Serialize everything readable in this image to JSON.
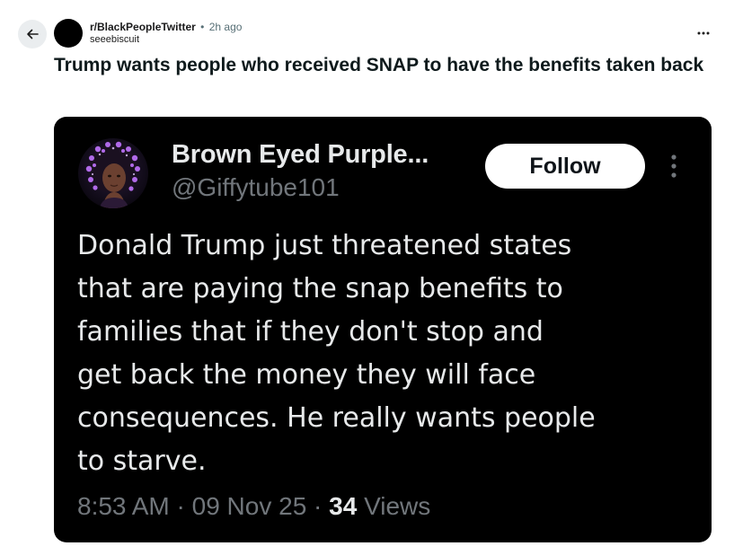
{
  "post": {
    "subreddit": "r/BlackPeopleTwitter",
    "separator": "•",
    "age": "2h ago",
    "author": "seeebiscuit",
    "title": "Trump wants people who received SNAP to have the benefits taken back"
  },
  "icons": {
    "back": "arrow-left-icon",
    "more": "ellipsis-horizontal-icon",
    "tweet_more": "ellipsis-vertical-icon"
  },
  "tweet": {
    "display_name": "Brown Eyed Purple...",
    "handle": "@Giffytube101",
    "follow_label": "Follow",
    "text": "Donald Trump just threatened states\nthat are paying the snap benefits to\nfamilies that if they don't stop and\nget back the money they will face\nconsequences. He really wants people\nto starve.",
    "time": "8:53 AM",
    "separator": "·",
    "date": "09 Nov 25",
    "views_count": "34",
    "views_label": "Views"
  },
  "colors": {
    "card_background": "#000000",
    "follow_button": "#ffffff",
    "muted_text": "#71767b",
    "avatar_glow": "#9b4ddb"
  }
}
